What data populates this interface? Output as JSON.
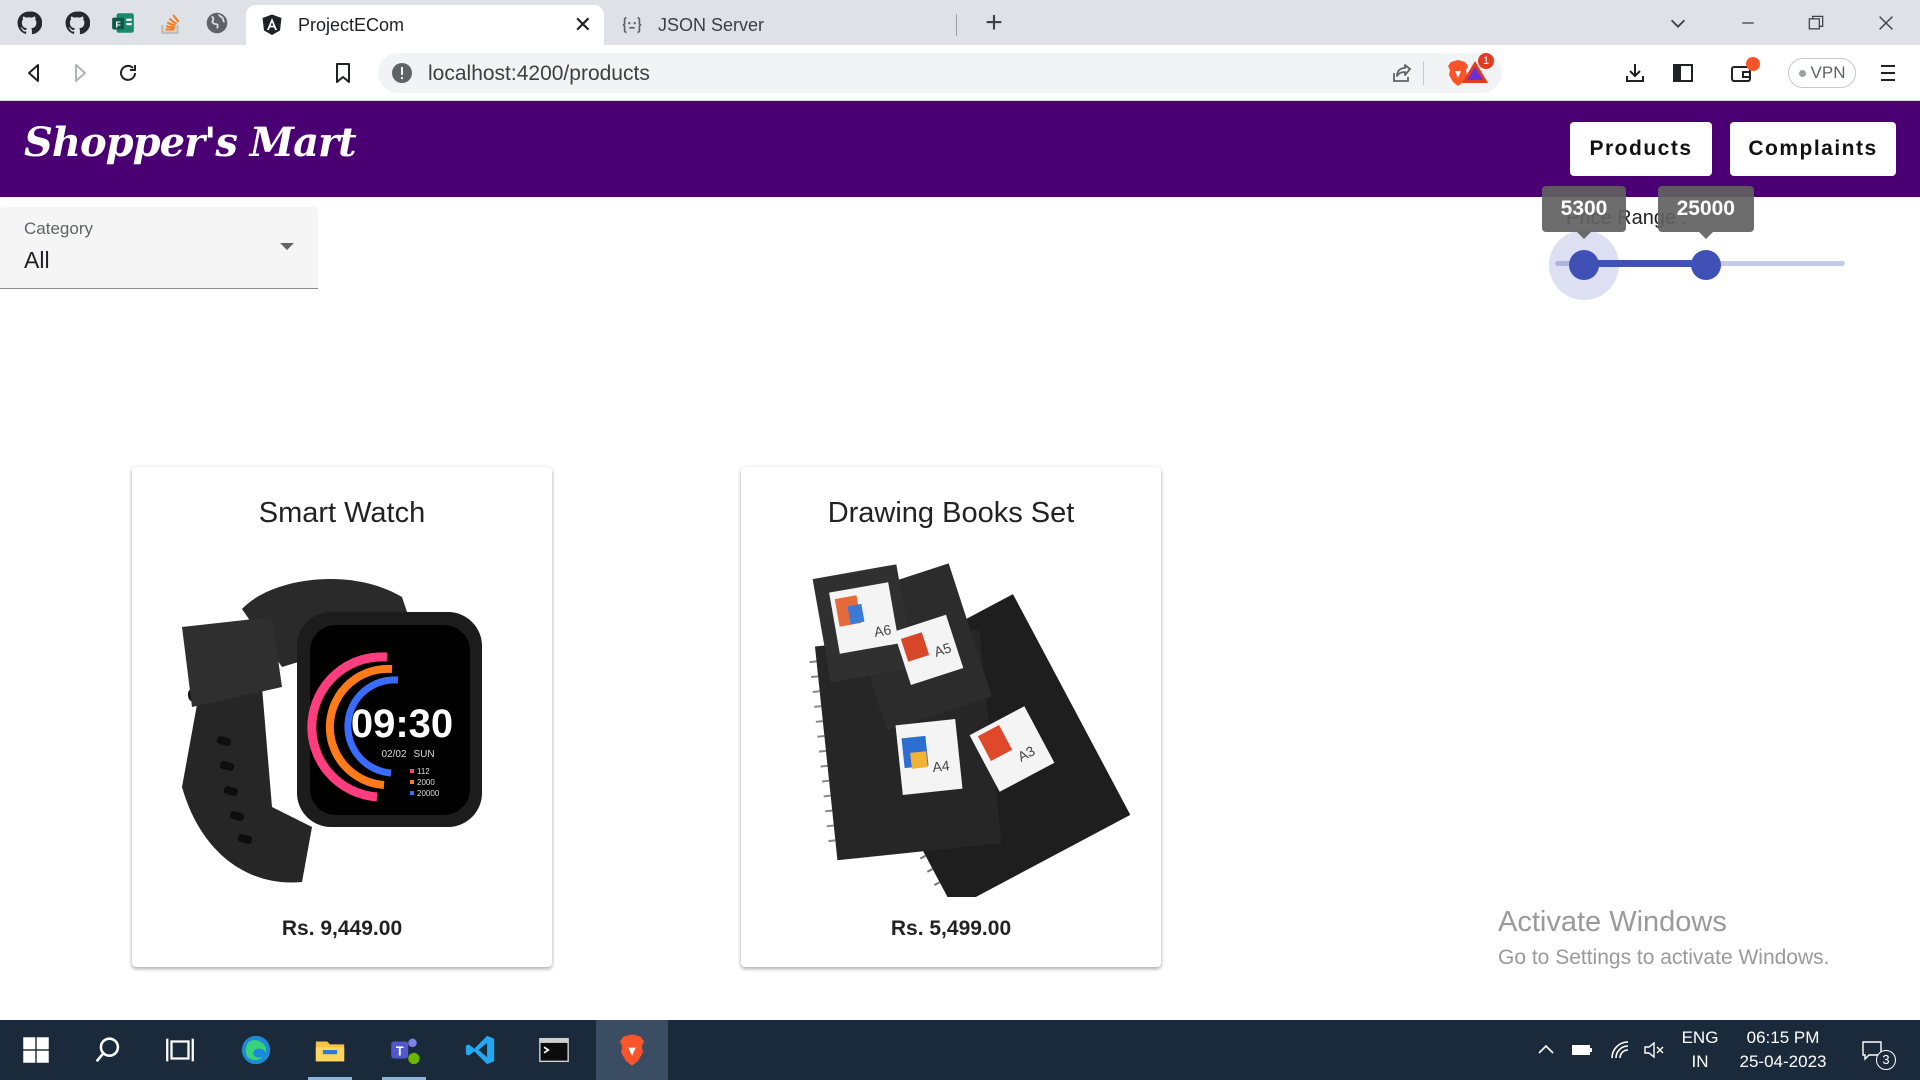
{
  "browser": {
    "tabs": [
      {
        "title": "ProjectECom",
        "active": true
      },
      {
        "title": "JSON Server",
        "active": false
      }
    ],
    "url": "localhost:4200/products",
    "rewards_badge": "1",
    "vpn_label": "VPN"
  },
  "app": {
    "brand": "Shopper's Mart",
    "nav": {
      "products": "Products",
      "complaints": "Complaints"
    },
    "accent_color": "#4a0072"
  },
  "filters": {
    "category": {
      "label": "Category",
      "value": "All"
    },
    "price_range": {
      "label": "Price Range :",
      "min_value": "5300",
      "max_value": "25000",
      "low_fraction": 0.1,
      "high_fraction": 0.52
    }
  },
  "products": [
    {
      "name": "Smart Watch",
      "price": "Rs. 9,449.00",
      "image": "smartwatch-image"
    },
    {
      "name": "Drawing Books Set",
      "price": "Rs. 5,499.00",
      "image": "sketchbooks-image"
    }
  ],
  "product_art": {
    "watch_time": "09:30",
    "watch_date": "02/02",
    "watch_day": "SUN",
    "watch_stats": [
      "112",
      "2000",
      "20000"
    ],
    "book_sizes": [
      "A6",
      "A5",
      "A4",
      "A3"
    ]
  },
  "watermark": {
    "title": "Activate Windows",
    "subtitle": "Go to Settings to activate Windows."
  },
  "taskbar": {
    "lang": [
      "ENG",
      "IN"
    ],
    "time": "06:15 PM",
    "date": "25-04-2023",
    "notifications": "3"
  }
}
